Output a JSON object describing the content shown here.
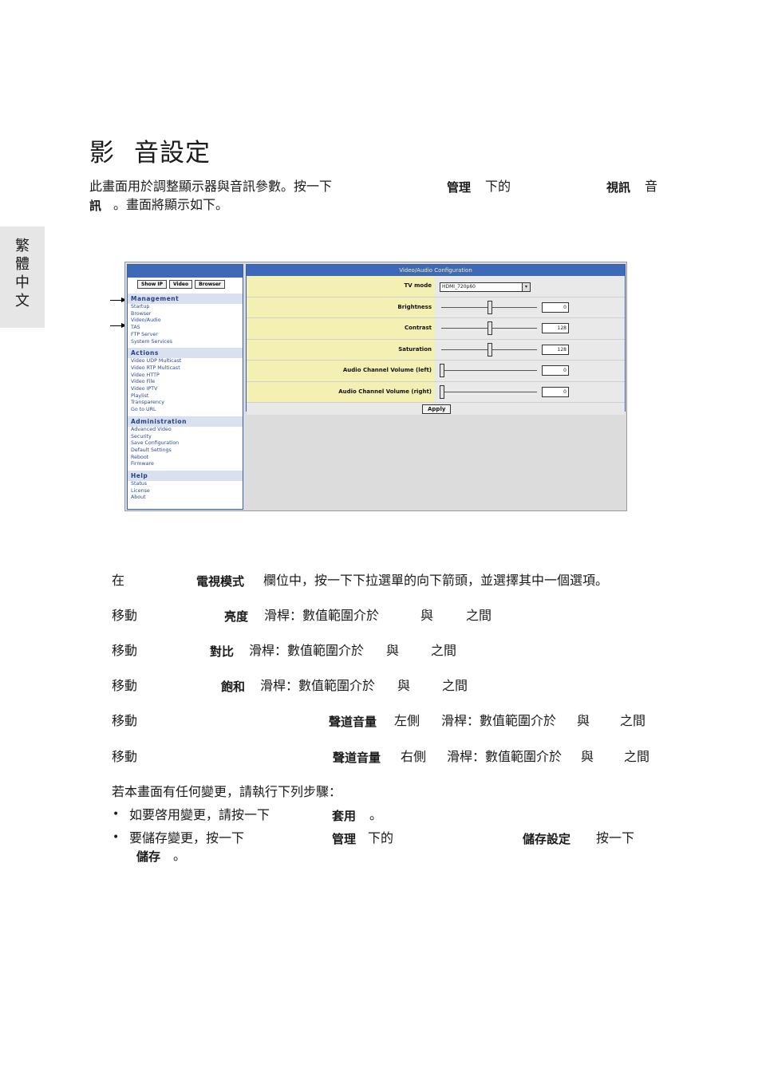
{
  "side_tab": [
    "繁",
    "體",
    "中",
    "文"
  ],
  "title_a": "影",
  "title_b": "音設定",
  "intro": {
    "line1_a": "此畫面用於調整顯示器與音訊參數。按一下",
    "line1_b": "管理",
    "line1_c": "下的",
    "line1_d": "視訊",
    "line1_e": "音",
    "line2_a": "訊",
    "line2_b": "。畫面將顯示如下。"
  },
  "screenshot": {
    "buttons": [
      "Show IP",
      "Video",
      "Browser"
    ],
    "sections": [
      {
        "title": "Management",
        "items": [
          "Startup",
          "Browser",
          "Video/Audio",
          "TAS",
          "FTP Server",
          "System Services"
        ]
      },
      {
        "title": "Actions",
        "items": [
          "Video UDP Multicast",
          "Video RTP Multicast",
          "Video HTTP",
          "Video File",
          "Video IPTV",
          "Playlist",
          "Transparency",
          "Go to URL"
        ]
      },
      {
        "title": "Administration",
        "items": [
          "Advanced Video",
          "Security",
          "Save Configuration",
          "Default Settings",
          "Reboot",
          "Firmware"
        ]
      },
      {
        "title": "Help",
        "items": [
          "Status",
          "License",
          "About"
        ]
      }
    ],
    "panel_title": "Video/Audio Configuration",
    "tv_mode_label": "TV mode",
    "tv_mode_value": "HDMI_720p60",
    "sliders": [
      {
        "label": "Brightness",
        "value": "0",
        "fraction": 0.5
      },
      {
        "label": "Contrast",
        "value": "128",
        "fraction": 0.5
      },
      {
        "label": "Saturation",
        "value": "128",
        "fraction": 0.5
      },
      {
        "label": "Audio Channel Volume (left)",
        "value": "0",
        "fraction": 0.0
      },
      {
        "label": "Audio Channel Volume (right)",
        "value": "0",
        "fraction": 0.0
      }
    ],
    "apply_label": "Apply"
  },
  "steps": [
    {
      "a": "在",
      "b": "電視模式",
      "c": "欄位中，按一下下拉選單的向下箭頭，並選擇其中一個選項。"
    },
    {
      "a": "移動",
      "b": "亮度",
      "c": "滑桿：數值範圍介於",
      "d": "與",
      "e": "之間"
    },
    {
      "a": "移動",
      "b": "對比",
      "c": "滑桿：數值範圍介於",
      "d": "與",
      "e": "之間"
    },
    {
      "a": "移動",
      "b": "飽和",
      "c": "滑桿：數值範圍介於",
      "d": "與",
      "e": "之間"
    },
    {
      "a": "移動",
      "b": "聲道音量",
      "b2": "左側",
      "c": "滑桿：數值範圍介於",
      "d": "與",
      "e": "之間"
    },
    {
      "a": "移動",
      "b": "聲道音量",
      "b2": "右側",
      "c": "滑桿：數值範圍介於",
      "d": "與",
      "e": "之間"
    }
  ],
  "changes_intro": "若本畫面有任何變更，請執行下列步驟：",
  "bullet1": {
    "a": "如要啓用變更，請按一下",
    "b": "套用",
    "c": "。"
  },
  "bullet2": {
    "a": "要儲存變更，按一下",
    "b": "管理",
    "c": "下的",
    "d": "儲存設定",
    "e": "按一下",
    "f": "儲存",
    "g": "。"
  }
}
